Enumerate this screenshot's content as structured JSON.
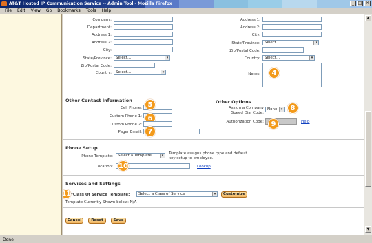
{
  "window": {
    "title": "AT&T Hosted IP Communication Service -- Admin Tool - Mozilla Firefox"
  },
  "menu": [
    "File",
    "Edit",
    "View",
    "Go",
    "Bookmarks",
    "Tools",
    "Help"
  ],
  "status": "Done",
  "left_form": {
    "company": "Company:",
    "department": "Department:",
    "address1": "Address 1:",
    "address2": "Address 2:",
    "city": "City:",
    "state": "State/Province:",
    "state_value": "Select...",
    "zip": "Zip/Postal Code:",
    "country": "Country:",
    "country_value": "Select..."
  },
  "right_form": {
    "address1": "Address 1:",
    "address2": "Address 2:",
    "city": "City:",
    "state": "State/Province:",
    "state_value": "Select...",
    "zip": "Zip/Postal Code:",
    "country": "Country:",
    "country_value": "Select...",
    "notes": "Notes:"
  },
  "other_contact": {
    "heading": "Other Contact Information",
    "cell": "Cell Phone:",
    "custom1": "Custom Phone 1:",
    "custom2": "Custom Phone 2:",
    "pager": "Pager Email:"
  },
  "other_options": {
    "heading": "Other Options",
    "speed_dial_1": "Assign a Company",
    "speed_dial_2": "Speed Dial Code:",
    "speed_dial_value": "None",
    "auth": "Authorization Code:",
    "help": "Help"
  },
  "phone_setup": {
    "heading": "Phone Setup",
    "template_label": "Phone Template:",
    "template_value": "Select a Template",
    "template_note_1": "Template assigns phone type and default",
    "template_note_2": "key setup to employee.",
    "location": "Location:",
    "lookup": "Lookup"
  },
  "services": {
    "heading": "Services and Settings",
    "cos_label": "*Class Of Service Template:",
    "cos_value": "Select a Class of Service",
    "customize": "Customize",
    "template_shown": "Template Currently Shown below: N/A"
  },
  "buttons": {
    "cancel": "Cancel",
    "reset": "Reset",
    "save": "Save"
  },
  "badges": {
    "b4": "4",
    "b5": "5",
    "b6": "6",
    "b7": "7",
    "b8": "8",
    "b9": "9",
    "b10": "10",
    "b11": "11"
  },
  "colors": {
    "badge": "#f39a1a",
    "button": "#f1b560",
    "link": "#1040c0"
  }
}
